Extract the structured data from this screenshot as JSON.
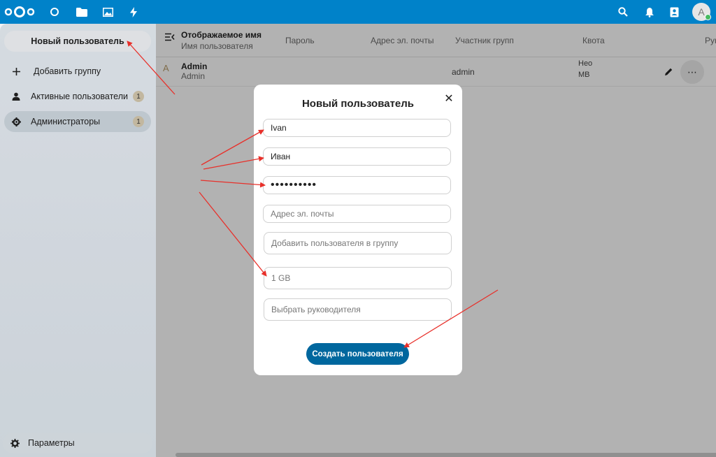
{
  "header": {
    "apps": [
      "nextcloud-logo",
      "dashboard-icon",
      "files-icon",
      "photos-icon",
      "activity-icon"
    ],
    "right_icons": [
      "search-icon",
      "notifications-icon",
      "contacts-icon"
    ],
    "avatar_letter": "A",
    "brand_color": "#0082c9"
  },
  "sidebar": {
    "new_user_label": "Новый пользователь",
    "items": [
      {
        "label": "Добавить группу",
        "icon": "plus-icon",
        "count": ""
      },
      {
        "label": "Активные пользователи",
        "icon": "user-icon",
        "count": "1"
      },
      {
        "label": "Администраторы",
        "icon": "admin-icon",
        "count": "1"
      }
    ],
    "settings_label": "Параметры"
  },
  "table": {
    "columns": {
      "display_name": "Отображаемое имя",
      "username": "Имя пользователя",
      "password": "Пароль",
      "email": "Адрес эл. почты",
      "groups": "Участник групп",
      "quota": "Квота",
      "manager": "Рук"
    },
    "rows": [
      {
        "avatar": "A",
        "display_name": "Admin",
        "username": "Admin",
        "groups": "admin",
        "quota_top": "Нео",
        "quota_bottom": "МВ"
      }
    ]
  },
  "modal": {
    "title": "Новый пользователь",
    "username_value": "Ivan",
    "display_name_value": "Иван",
    "password_value": "••••••••••",
    "email_placeholder": "Адрес эл. почты",
    "group_placeholder": "Добавить пользователя в группу",
    "quota_placeholder": "1 GB",
    "manager_placeholder": "Выбрать руководителя",
    "create_label": "Создать пользователя",
    "button_color": "#00679e"
  }
}
